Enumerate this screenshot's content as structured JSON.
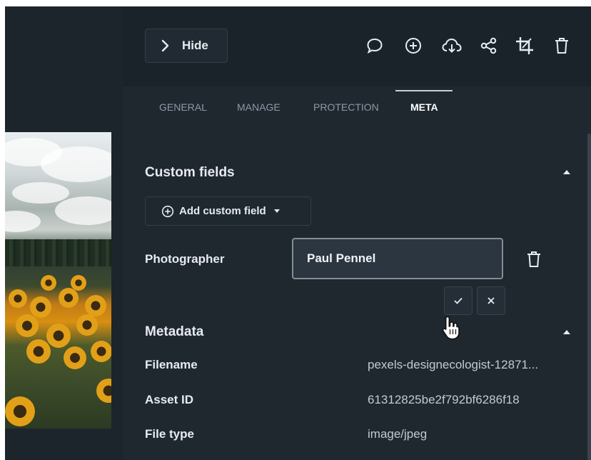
{
  "header": {
    "hide_label": "Hide",
    "icons": [
      "comment-icon",
      "add-circle-icon",
      "cloud-download-icon",
      "share-icon",
      "crop-icon",
      "trash-icon"
    ]
  },
  "tabs": [
    {
      "label": "GENERAL",
      "active": false
    },
    {
      "label": "MANAGE",
      "active": false
    },
    {
      "label": "PROTECTION",
      "active": false
    },
    {
      "label": "META",
      "active": true
    }
  ],
  "custom_fields": {
    "title": "Custom fields",
    "add_button_label": "Add custom field",
    "fields": [
      {
        "label": "Photographer",
        "value": "Paul Pennel"
      }
    ]
  },
  "metadata": {
    "title": "Metadata",
    "rows": [
      {
        "label": "Filename",
        "value": "pexels-designecologist-12871..."
      },
      {
        "label": "Asset ID",
        "value": "61312825be2f792bf6286f18"
      },
      {
        "label": "File type",
        "value": "image/jpeg"
      }
    ]
  },
  "colors": {
    "panel_bg": "#1f272f",
    "topbar_bg": "#1b232a",
    "text": "#e6ebf0",
    "muted_tab": "#8c9aa6",
    "input_bg": "#2c3640",
    "input_border": "#848c94"
  }
}
